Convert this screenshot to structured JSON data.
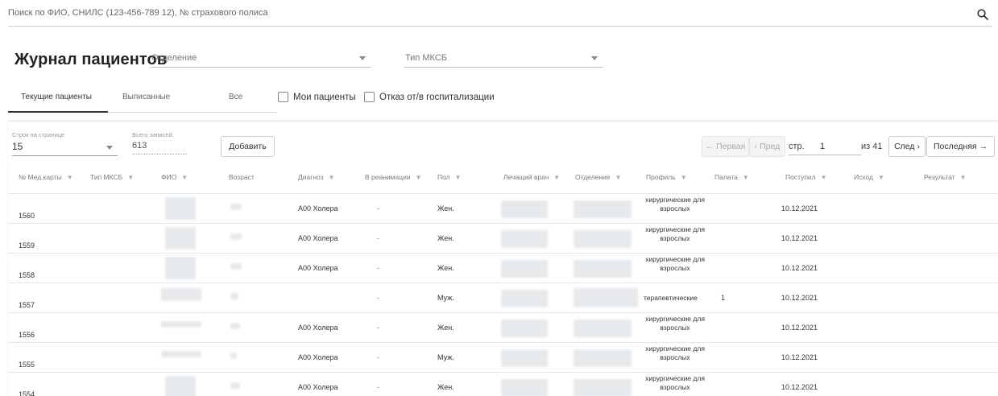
{
  "search": {
    "placeholder": "Поиск по ФИО, СНИЛС (123-456-789 12), № страхового полиса"
  },
  "title": "Журнал пациентов",
  "filters": {
    "department_label": "Отделение",
    "type_label": "Тип МКСБ"
  },
  "tabs": [
    "Текущие пациенты",
    "Выписанные",
    "Все"
  ],
  "checkboxes": [
    "Мои пациенты",
    "Отказ от/в госпитализации"
  ],
  "table_controls": {
    "rows_per_page_label": "Строк на странице",
    "rows_per_page_value": "15",
    "total_label": "Всего записей:",
    "total_value": "613",
    "add_button": "Добавить"
  },
  "pagination": {
    "first": "← Первая",
    "prev": "‹ Пред",
    "page_label": "стр.",
    "page": "1",
    "of": "из 41",
    "next": "След ›",
    "last": "Последняя →"
  },
  "columns": [
    "№ Мед.карты",
    "Тип МКСБ",
    "ФИО",
    "Возраст",
    "Диагноз",
    "В реанимации",
    "Пол",
    "Лечащий врач",
    "Отделение",
    "Профиль",
    "Палата",
    "Поступил",
    "Исход",
    "Результат"
  ],
  "rows": [
    {
      "id": "1560",
      "diagnosis": "A00 Холера",
      "icu": "-",
      "sex": "Жен.",
      "profile": "хирургические для взрослых",
      "ward": "",
      "admitted": "10.12.2021"
    },
    {
      "id": "1559",
      "diagnosis": "A00 Холера",
      "icu": "-",
      "sex": "Жен.",
      "profile": "хирургические для взрослых",
      "ward": "",
      "admitted": "10.12.2021"
    },
    {
      "id": "1558",
      "diagnosis": "A00 Холера",
      "icu": "-",
      "sex": "Жен.",
      "profile": "хирургические для взрослых",
      "ward": "",
      "admitted": "10.12.2021"
    },
    {
      "id": "1557",
      "diagnosis": "",
      "icu": "-",
      "sex": "Муж.",
      "profile": "терапевтические",
      "ward": "1",
      "admitted": "10.12.2021"
    },
    {
      "id": "1556",
      "diagnosis": "A00 Холера",
      "icu": "-",
      "sex": "Жен.",
      "profile": "хирургические для взрослых",
      "ward": "",
      "admitted": "10.12.2021"
    },
    {
      "id": "1555",
      "diagnosis": "A00 Холера",
      "icu": "-",
      "sex": "Муж.",
      "profile": "хирургические для взрослых",
      "ward": "",
      "admitted": "10.12.2021"
    },
    {
      "id": "1554",
      "diagnosis": "A00 Холера",
      "icu": "-",
      "sex": "Жен.",
      "profile": "хирургические для взрослых",
      "ward": "",
      "admitted": "10.12.2021"
    }
  ]
}
